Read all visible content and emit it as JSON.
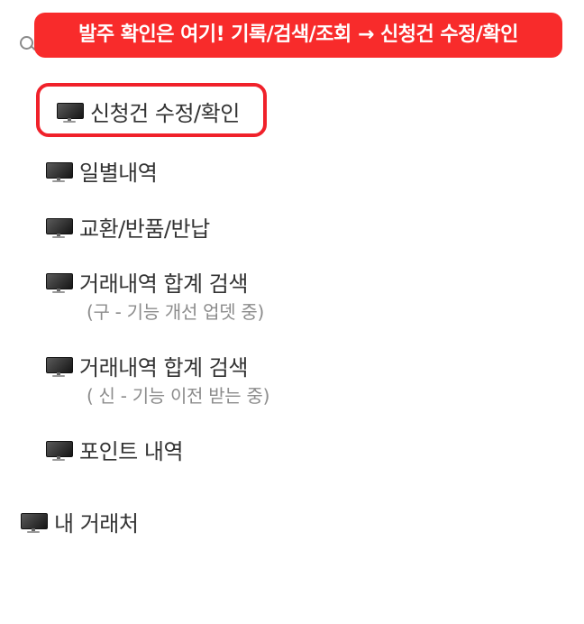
{
  "banner": {
    "text": "발주 확인은 여기! 기록/검색/조회 → 신청건 수정/확인"
  },
  "menu": {
    "items": [
      {
        "label": "신청건 수정/확인",
        "icon": "monitor-icon"
      },
      {
        "label": "일별내역",
        "icon": "monitor-icon"
      },
      {
        "label": "교환/반품/반납",
        "icon": "monitor-icon"
      },
      {
        "label": "거래내역 합계 검색",
        "sub": "(구 - 기능 개선 업뎃 중)",
        "icon": "monitor-icon"
      },
      {
        "label": "거래내역 합계 검색",
        "sub": "( 신 - 기능 이전 받는 중)",
        "icon": "monitor-icon"
      },
      {
        "label": "포인트 내역",
        "icon": "monitor-icon"
      }
    ],
    "section": {
      "label": "내 거래처",
      "icon": "monitor-icon"
    }
  },
  "colors": {
    "banner": "#f82b2b",
    "highlight": "#f0212a",
    "text": "#333333",
    "subtext": "#8c8c8c"
  }
}
